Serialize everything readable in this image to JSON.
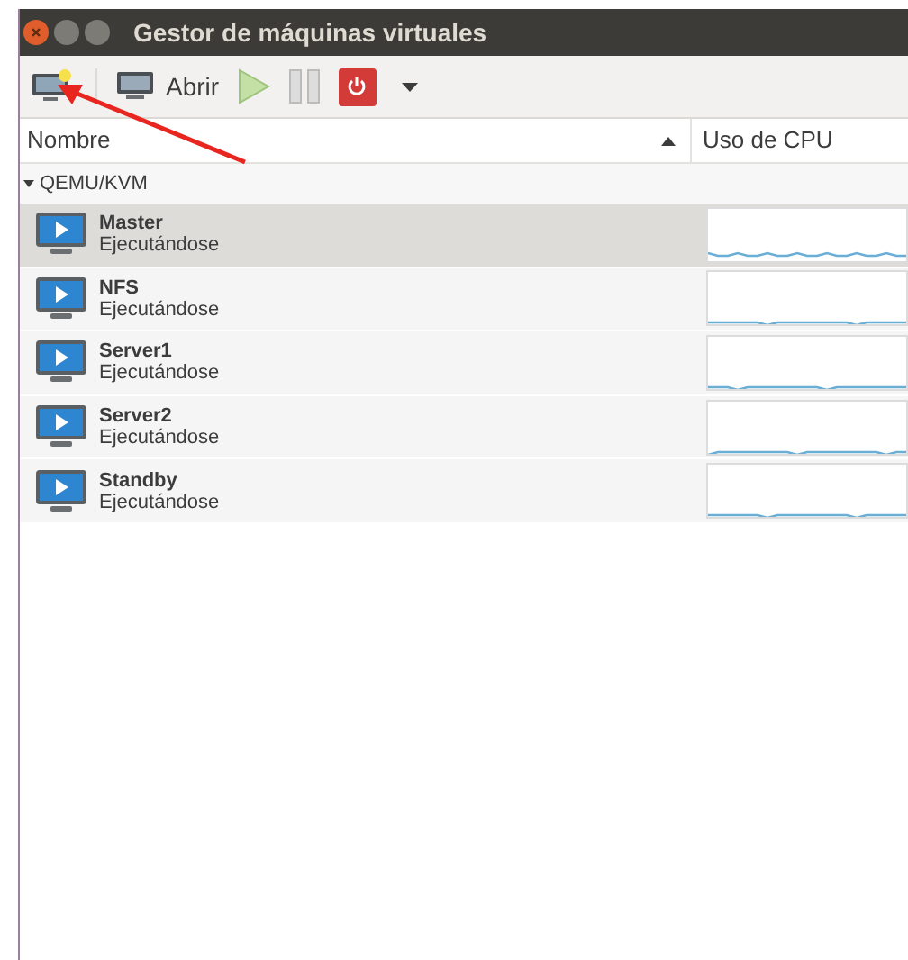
{
  "window": {
    "title": "Gestor de máquinas virtuales"
  },
  "toolbar": {
    "open_label": "Abrir"
  },
  "table": {
    "columns": [
      {
        "label": "Nombre",
        "sorted": true
      },
      {
        "label": "Uso de CPU",
        "sorted": false
      }
    ],
    "group": {
      "label": "QEMU/KVM",
      "expanded": true
    },
    "rows": [
      {
        "name": "Master",
        "status": "Ejecutándose",
        "selected": true
      },
      {
        "name": "NFS",
        "status": "Ejecutándose",
        "selected": false
      },
      {
        "name": "Server1",
        "status": "Ejecutándose",
        "selected": false
      },
      {
        "name": "Server2",
        "status": "Ejecutándose",
        "selected": false
      },
      {
        "name": "Standby",
        "status": "Ejecutándose",
        "selected": false
      }
    ]
  }
}
